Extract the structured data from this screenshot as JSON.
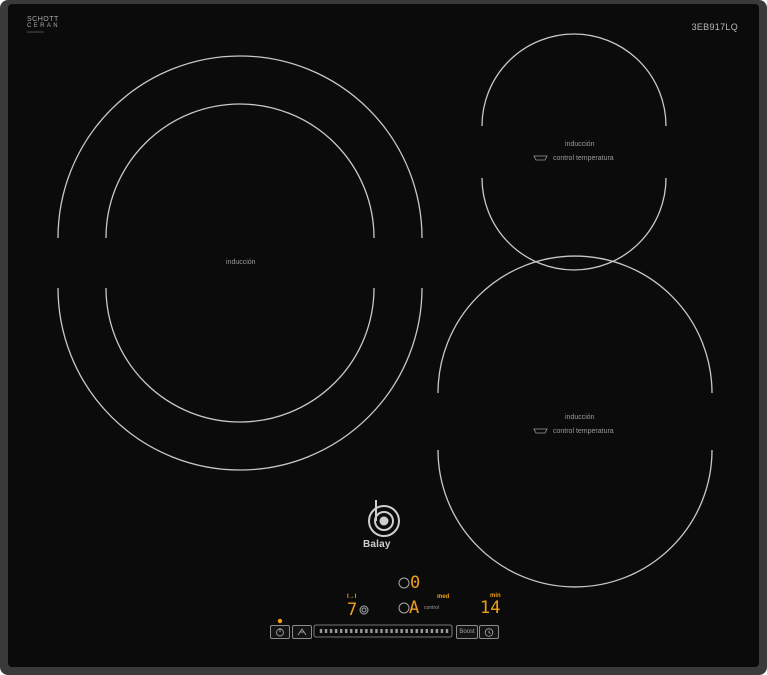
{
  "hob": {
    "model": "3EB917LQ",
    "brand_logo": {
      "line1": "SCHOTT",
      "line2": "CERAN",
      "line3": "0000000000"
    },
    "zone_labels": {
      "large_left": "inducción",
      "top_right": {
        "line1": "inducción",
        "line2": "control temperatura"
      },
      "bottom_right": {
        "line1": "inducción",
        "line2": "control temperatura"
      }
    },
    "maker_logo_text": "Balay"
  },
  "control_panel": {
    "top_display": "0",
    "left_display": "7",
    "left_icon_label": "I→I",
    "middle_display": "A",
    "middle_tag": "med",
    "middle_sub": "control",
    "timer_display": "14",
    "timer_tag": "min",
    "boost_label": "Boost",
    "slider_dot_count": 26
  },
  "colors": {
    "glass": "#0b0b0b",
    "frame": "#3a3a3a",
    "zone_line": "#c8c8c8",
    "display_accent": "#f0a018"
  },
  "icons": [
    "power-icon",
    "wipe-protection-icon",
    "timer-clock-icon",
    "pan-icon",
    "zone-select-icon"
  ]
}
